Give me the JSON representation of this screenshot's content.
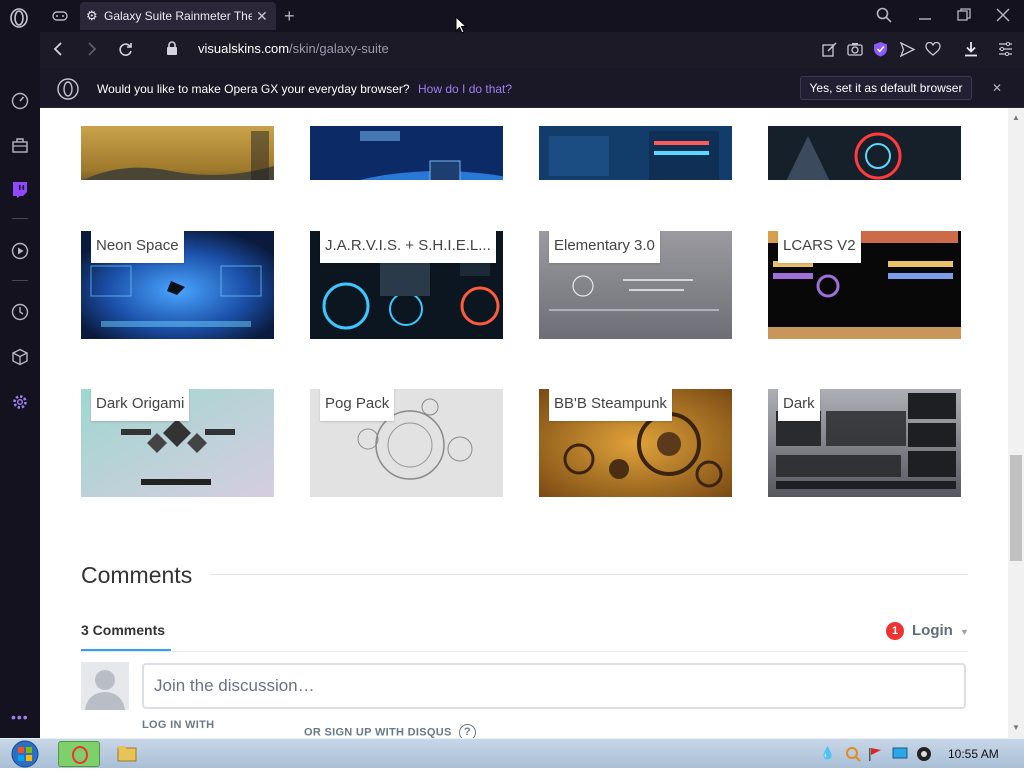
{
  "browser": {
    "tab_title": "Galaxy Suite Rainmeter The",
    "url_host": "visualskins.com",
    "url_path": "/skin/galaxy-suite",
    "prompt_message": "Would you like to make Opera GX your everyday browser?",
    "prompt_link": "How do I do that?",
    "prompt_button": "Yes, set it as default browser"
  },
  "gallery": {
    "items": [
      {
        "label": "Neon Space"
      },
      {
        "label": "J.A.R.V.I.S. + S.H.I.E.L..."
      },
      {
        "label": "Elementary 3.0"
      },
      {
        "label": "LCARS V2"
      },
      {
        "label": "Dark Origami"
      },
      {
        "label": "Pog Pack"
      },
      {
        "label": "BB'B Steampunk"
      },
      {
        "label": "Dark"
      }
    ]
  },
  "comments": {
    "title": "Comments",
    "count": "3 Comments",
    "login_badge": "1",
    "login": "Login",
    "placeholder": "Join the discussion…",
    "login_with": "LOG IN WITH",
    "signup": "OR SIGN UP WITH DISQUS"
  },
  "taskbar": {
    "clock": "10:55 AM"
  },
  "colors": {
    "accent": "#9e7ff0",
    "disqus_blue": "#2e9fff"
  }
}
